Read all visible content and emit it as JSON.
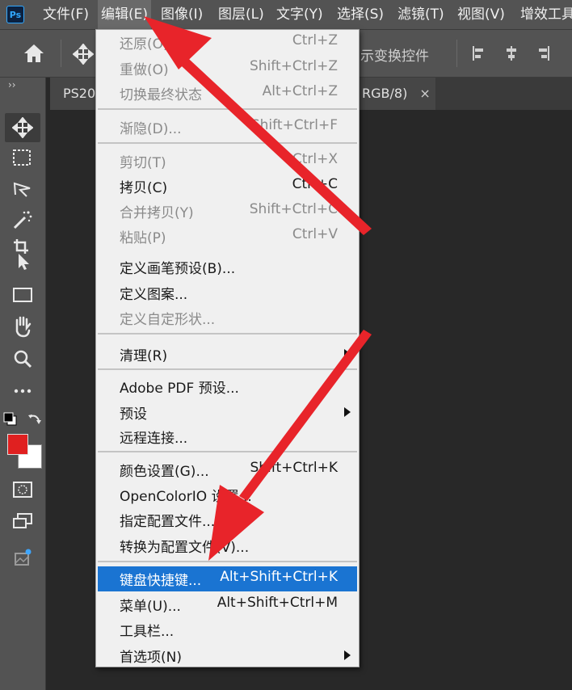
{
  "app": {
    "logo_text": "Ps"
  },
  "menubar": {
    "items": [
      {
        "label": "文件(F)"
      },
      {
        "label": "编辑(E)"
      },
      {
        "label": "图像(I)"
      },
      {
        "label": "图层(L)"
      },
      {
        "label": "文字(Y)"
      },
      {
        "label": "选择(S)"
      },
      {
        "label": "滤镜(T)"
      },
      {
        "label": "视图(V)"
      },
      {
        "label": "增效工具"
      }
    ]
  },
  "options_bar": {
    "transform_controls_text": "示变换控件"
  },
  "tabs": {
    "doc_tab_left": "PS20",
    "doc_tab_right": "RGB/8)",
    "close_glyph": "×"
  },
  "toolbar": {
    "collapse_glyph": "››",
    "foreground_color": "#e02020",
    "background_color": "#ffffff"
  },
  "edit_menu": {
    "items": [
      {
        "label": "还原(O)",
        "shortcut": "Ctrl+Z",
        "enabled": false
      },
      {
        "label": "重做(O)",
        "shortcut": "Shift+Ctrl+Z",
        "enabled": false
      },
      {
        "label": "切换最终状态",
        "shortcut": "Alt+Ctrl+Z",
        "enabled": false
      },
      {
        "label": "渐隐(D)...",
        "shortcut": "Shift+Ctrl+F",
        "enabled": false
      },
      {
        "label": "剪切(T)",
        "shortcut": "Ctrl+X",
        "enabled": false
      },
      {
        "label": "拷贝(C)",
        "shortcut": "Ctrl+C",
        "enabled": true
      },
      {
        "label": "合并拷贝(Y)",
        "shortcut": "Shift+Ctrl+C",
        "enabled": false
      },
      {
        "label": "粘贴(P)",
        "shortcut": "Ctrl+V",
        "enabled": false
      },
      {
        "label": "定义画笔预设(B)...",
        "shortcut": "",
        "enabled": true
      },
      {
        "label": "定义图案...",
        "shortcut": "",
        "enabled": true
      },
      {
        "label": "定义自定形状...",
        "shortcut": "",
        "enabled": false
      },
      {
        "label": "清理(R)",
        "shortcut": "",
        "enabled": true,
        "submenu": true
      },
      {
        "label": "Adobe PDF 预设...",
        "shortcut": "",
        "enabled": true
      },
      {
        "label": "预设",
        "shortcut": "",
        "enabled": true,
        "submenu": true
      },
      {
        "label": "远程连接...",
        "shortcut": "",
        "enabled": true
      },
      {
        "label": "颜色设置(G)...",
        "shortcut": "Shift+Ctrl+K",
        "enabled": true
      },
      {
        "label": "OpenColorIO 设置...",
        "shortcut": "",
        "enabled": true
      },
      {
        "label": "指定配置文件...",
        "shortcut": "",
        "enabled": true
      },
      {
        "label": "转换为配置文件(V)...",
        "shortcut": "",
        "enabled": true
      },
      {
        "label": "键盘快捷键...",
        "shortcut": "Alt+Shift+Ctrl+K",
        "enabled": true,
        "highlighted": true
      },
      {
        "label": "菜单(U)...",
        "shortcut": "Alt+Shift+Ctrl+M",
        "enabled": true
      },
      {
        "label": "工具栏...",
        "shortcut": "",
        "enabled": true
      },
      {
        "label": "首选项(N)",
        "shortcut": "",
        "enabled": true,
        "submenu": true
      }
    ]
  },
  "annotations": {
    "arrow_color": "#e8242a"
  }
}
